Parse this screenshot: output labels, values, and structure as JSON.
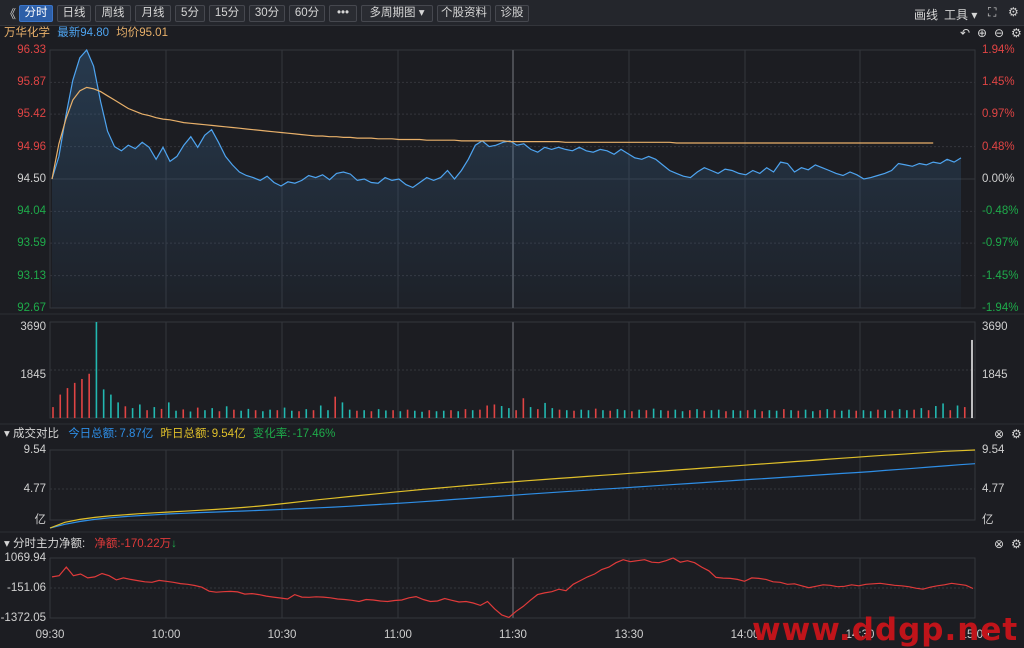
{
  "toolbar": {
    "back": "《",
    "tabs": [
      {
        "label": "分时",
        "active": true
      },
      {
        "label": "日线",
        "active": false
      },
      {
        "label": "周线",
        "active": false
      },
      {
        "label": "月线",
        "active": false
      },
      {
        "label": "5分",
        "active": false
      },
      {
        "label": "15分",
        "active": false
      },
      {
        "label": "30分",
        "active": false
      },
      {
        "label": "60分",
        "active": false
      },
      {
        "label": "•••",
        "active": false
      },
      {
        "label": "多周期图 ▾",
        "active": false
      },
      {
        "label": "个股资料",
        "active": false
      },
      {
        "label": "诊股",
        "active": false
      }
    ],
    "right": {
      "draw": "画线",
      "tools": "工具 ▾"
    }
  },
  "price_header": {
    "name": "万华化学",
    "last_label": "最新",
    "last_value": "94.80",
    "avg_label": "均价",
    "avg_value": "95.01"
  },
  "volume_header": {},
  "turnover_header": {
    "title": "成交对比",
    "today_label": "今日总额:",
    "today_value": "7.87亿",
    "yesterday_label": "昨日总额:",
    "yesterday_value": "9.54亿",
    "change_label": "变化率:",
    "change_value": "-17.46%"
  },
  "flow_header": {
    "title": "分时主力净额:",
    "net_label": "净额:",
    "net_value": "-170.22万",
    "arrow": "↓"
  },
  "watermark": "www.ddgp.net",
  "colors": {
    "price": "#4ea4f0",
    "avg": "#e8b06a",
    "up": "#e04444",
    "down": "#1eaa4a",
    "turnover_today": "#2e8ee6",
    "turnover_yesterday": "#e0c02a",
    "flow": "#e03a3a",
    "bg": "#1c1d22",
    "grid": "#34363c"
  },
  "icons": [
    "back-icon",
    "more-icon",
    "dropdown-icon",
    "fullscreen-icon",
    "settings-icon",
    "reset-icon",
    "zoom-in-icon",
    "zoom-out-icon",
    "collapse-icon",
    "close-icon"
  ],
  "chart_data": [
    {
      "type": "line",
      "name": "price",
      "title": "万华化学",
      "x_labels": [
        "09:30",
        "10:00",
        "10:30",
        "11:00",
        "11:30",
        "13:30",
        "14:00",
        "14:30",
        "15:00"
      ],
      "y_ticks_left": [
        "96.33",
        "95.87",
        "95.42",
        "94.96",
        "94.50",
        "94.04",
        "93.59",
        "93.13",
        "92.67"
      ],
      "y_ticks_right": [
        "1.94%",
        "1.45%",
        "0.97%",
        "0.48%",
        "0.00%",
        "-0.48%",
        "-0.97%",
        "-1.45%",
        "-1.94%"
      ],
      "ylim": [
        92.67,
        96.33
      ],
      "prev_close": 94.5,
      "series": [
        {
          "name": "最新",
          "values": [
            94.5,
            94.82,
            95.4,
            95.9,
            96.22,
            96.33,
            96.1,
            95.6,
            95.18,
            94.96,
            94.9,
            94.98,
            94.93,
            95.02,
            94.95,
            94.78,
            94.95,
            94.75,
            94.82,
            94.98,
            95.1,
            94.95,
            95.12,
            95.2,
            95.02,
            94.82,
            94.7,
            94.6,
            94.55,
            94.52,
            94.48,
            94.54,
            94.45,
            94.4,
            94.46,
            94.44,
            94.48,
            94.55,
            94.52,
            94.56,
            94.49,
            94.58,
            94.6,
            94.57,
            94.48,
            94.5,
            94.45,
            94.44,
            94.52,
            94.48,
            94.5,
            94.42,
            94.38,
            94.45,
            94.52,
            94.48,
            94.52,
            94.62,
            94.5,
            94.62,
            94.78,
            94.98,
            95.04,
            94.96,
            94.98,
            95.02,
            95.04,
            94.98,
            95.0,
            94.92,
            94.88,
            94.95,
            94.92,
            94.95,
            94.92,
            94.9,
            94.95,
            94.9,
            94.88,
            94.92,
            94.9,
            94.85,
            94.92,
            94.86,
            94.8,
            94.78,
            94.82,
            94.78,
            94.7,
            94.62,
            94.58,
            94.54,
            94.52,
            94.6,
            94.66,
            94.62,
            94.58,
            94.64,
            94.62,
            94.58,
            94.56,
            94.62,
            94.58,
            94.66,
            94.6,
            94.74,
            94.72,
            94.6,
            94.66,
            94.63,
            94.7,
            94.66,
            94.62,
            94.58,
            94.55,
            94.6,
            94.56,
            94.5,
            94.52,
            94.55,
            94.58,
            94.62,
            94.72,
            94.7,
            94.68,
            94.72,
            94.7,
            94.74,
            94.72,
            94.78,
            94.74,
            94.8
          ]
        },
        {
          "name": "均价",
          "values": [
            94.5,
            95.0,
            95.35,
            95.62,
            95.75,
            95.8,
            95.78,
            95.74,
            95.68,
            95.62,
            95.56,
            95.5,
            95.46,
            95.42,
            95.4,
            95.37,
            95.35,
            95.34,
            95.32,
            95.3,
            95.29,
            95.28,
            95.27,
            95.26,
            95.25,
            95.24,
            95.23,
            95.22,
            95.21,
            95.2,
            95.19,
            95.18,
            95.17,
            95.16,
            95.15,
            95.14,
            95.13,
            95.12,
            95.11,
            95.11,
            95.1,
            95.1,
            95.09,
            95.09,
            95.08,
            95.08,
            95.08,
            95.07,
            95.07,
            95.07,
            95.06,
            95.06,
            95.06,
            95.06,
            95.05,
            95.05,
            95.05,
            95.05,
            95.05,
            95.04,
            95.04,
            95.04,
            95.04,
            95.04,
            95.04,
            95.04,
            95.03,
            95.03,
            95.03,
            95.03,
            95.03,
            95.03,
            95.03,
            95.03,
            95.02,
            95.02,
            95.02,
            95.02,
            95.02,
            95.02,
            95.02,
            95.02,
            95.02,
            95.02,
            95.02,
            95.02,
            95.02,
            95.02,
            95.02,
            95.02,
            95.01,
            95.01,
            95.01,
            95.01,
            95.01,
            95.01,
            95.01,
            95.01,
            95.01,
            95.01,
            95.01,
            95.01,
            95.01,
            95.01,
            95.01,
            95.01,
            95.01,
            95.01,
            95.01,
            95.01,
            95.01,
            95.01,
            95.01,
            95.01,
            95.01,
            95.01,
            95.01,
            95.01,
            95.01,
            95.01,
            95.01,
            95.01,
            95.01,
            95.01,
            95.01,
            95.01,
            95.01,
            95.01
          ]
        }
      ]
    },
    {
      "type": "bar",
      "name": "volume",
      "y_ticks": [
        "3690",
        "1845"
      ],
      "ylim": [
        0,
        3690
      ],
      "values": [
        420,
        900,
        1150,
        1350,
        1500,
        1700,
        3690,
        1100,
        900,
        600,
        450,
        380,
        520,
        300,
        420,
        350,
        600,
        280,
        330,
        250,
        400,
        300,
        380,
        260,
        450,
        320,
        280,
        350,
        300,
        260,
        320,
        300,
        400,
        280,
        260,
        340,
        300,
        480,
        300,
        820,
        600,
        320,
        280,
        300,
        260,
        340,
        290,
        300,
        260,
        320,
        280,
        240,
        300,
        260,
        280,
        300,
        260,
        340,
        300,
        320,
        480,
        520,
        460,
        380,
        300,
        760,
        420,
        340,
        580,
        380,
        320,
        300,
        280,
        320,
        300,
        360,
        300,
        280,
        340,
        300,
        260,
        320,
        300,
        360,
        300,
        280,
        320,
        260,
        300,
        340,
        280,
        300,
        320,
        260,
        300,
        280,
        300,
        320,
        260,
        300,
        280,
        340,
        300,
        280,
        320,
        260,
        300,
        340,
        300,
        280,
        320,
        280,
        300,
        260,
        320,
        300,
        280,
        340,
        300,
        320,
        380,
        300,
        460,
        560,
        300,
        480,
        420,
        3000
      ],
      "up": [
        1,
        1,
        1,
        1,
        1,
        1,
        0,
        0,
        0,
        0,
        1,
        0,
        0,
        1,
        0,
        1,
        0,
        0,
        1,
        0,
        1,
        0,
        0,
        1,
        0,
        1,
        0,
        0,
        1,
        0,
        0,
        1,
        0,
        0,
        1,
        0,
        1,
        0,
        0,
        1,
        0,
        0,
        1,
        0,
        1,
        0,
        0,
        1,
        0,
        1,
        0,
        0,
        1,
        0,
        0,
        1,
        0,
        1,
        0,
        1,
        1,
        1,
        0,
        0,
        1,
        1,
        0,
        1,
        0,
        0,
        1,
        0,
        1,
        0,
        0,
        1,
        0,
        1,
        0,
        0,
        1,
        0,
        1,
        0,
        0,
        1,
        0,
        0,
        1,
        0,
        1,
        0,
        0,
        1,
        0,
        0,
        1,
        0,
        1,
        0,
        0,
        1,
        0,
        1,
        0,
        0,
        1,
        0,
        1,
        0,
        0,
        1,
        0,
        0,
        1,
        0,
        1,
        0,
        0,
        1,
        0,
        1,
        0,
        0,
        1,
        0,
        1,
        0,
        0,
        1
      ]
    },
    {
      "type": "line",
      "name": "turnover",
      "y_ticks": [
        "9.54",
        "4.77",
        "亿"
      ],
      "ylim": [
        0,
        9.54
      ],
      "series": [
        {
          "name": "今日总额",
          "values": [
            0,
            0.45,
            0.8,
            1.05,
            1.25,
            1.4,
            1.52,
            1.62,
            1.72,
            1.8,
            1.88,
            1.95,
            2.02,
            2.08,
            2.15,
            2.22,
            2.3,
            2.38,
            2.47,
            2.56,
            2.66,
            2.76,
            2.87,
            2.98,
            3.1,
            3.22,
            3.35,
            3.48,
            3.61,
            3.74,
            3.87,
            4.0,
            4.13,
            4.26,
            4.38,
            4.5,
            4.62,
            4.74,
            4.86,
            4.98,
            5.1,
            5.22,
            5.34,
            5.46,
            5.58,
            5.7,
            5.82,
            5.94,
            6.06,
            6.18,
            6.3,
            6.42,
            6.54,
            6.66,
            6.78,
            6.9,
            7.04,
            7.18,
            7.32,
            7.46,
            7.6,
            7.74,
            7.87
          ]
        },
        {
          "name": "昨日总额",
          "values": [
            0,
            0.7,
            1.05,
            1.3,
            1.48,
            1.62,
            1.75,
            1.86,
            1.96,
            2.06,
            2.16,
            2.26,
            2.38,
            2.52,
            2.68,
            2.86,
            3.06,
            3.26,
            3.46,
            3.65,
            3.84,
            4.02,
            4.2,
            4.38,
            4.55,
            4.72,
            4.88,
            5.04,
            5.2,
            5.35,
            5.5,
            5.64,
            5.78,
            5.92,
            6.05,
            6.18,
            6.31,
            6.44,
            6.57,
            6.7,
            6.83,
            6.96,
            7.09,
            7.22,
            7.35,
            7.48,
            7.61,
            7.74,
            7.87,
            8.0,
            8.13,
            8.26,
            8.39,
            8.52,
            8.65,
            8.78,
            8.9,
            9.02,
            9.14,
            9.26,
            9.38,
            9.46,
            9.54
          ]
        }
      ]
    },
    {
      "type": "line",
      "name": "main_net_flow",
      "y_ticks": [
        "1069.94",
        "-151.06",
        "-1372.05"
      ],
      "ylim": [
        -1372.05,
        1069.94
      ],
      "values": [
        300,
        350,
        700,
        350,
        420,
        260,
        300,
        440,
        350,
        180,
        260,
        200,
        150,
        100,
        80,
        160,
        120,
        80,
        30,
        0,
        -50,
        -120,
        -280,
        -320,
        -300,
        -290,
        -310,
        -400,
        -380,
        -420,
        -480,
        -520,
        -560,
        -600,
        -420,
        -520,
        -530,
        -510,
        -520,
        -550,
        -600,
        -620,
        -650,
        -700,
        -620,
        -640,
        -680,
        -700,
        -660,
        -640,
        -550,
        -500,
        -620,
        -700,
        -680,
        -580,
        -650,
        -720,
        -700,
        -760,
        -860,
        -700,
        -1000,
        -1250,
        -1350,
        -1100,
        -900,
        -650,
        -420,
        -350,
        -300,
        -200,
        -260,
        0,
        150,
        300,
        420,
        600,
        700,
        880,
        1000,
        920,
        960,
        1000,
        900,
        880,
        960,
        1069,
        900,
        960,
        880,
        700,
        550,
        280,
        250,
        240,
        200,
        120,
        260,
        240,
        200,
        100,
        80,
        0,
        20,
        -60,
        -140,
        -80,
        -20,
        -40,
        -100,
        -80,
        -20,
        -60,
        0,
        20,
        40,
        0,
        -40,
        -60,
        -100,
        -160,
        -200,
        -120,
        -60,
        -20,
        40,
        0,
        -40,
        -170
      ]
    }
  ]
}
